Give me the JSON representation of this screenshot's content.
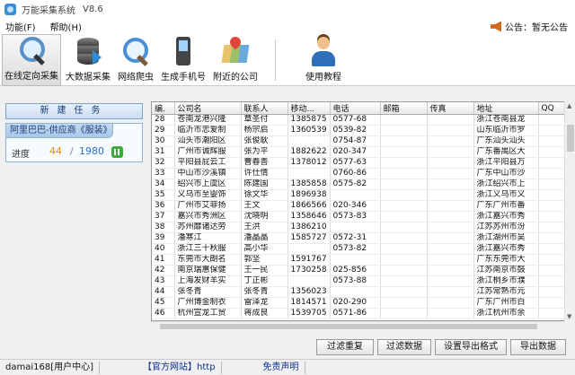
{
  "window": {
    "title": "万能采集系统",
    "version": "V8.6"
  },
  "menu": [
    "功能(F)",
    "帮助(H)"
  ],
  "notice": "公告：暂无公告",
  "toolbar": [
    {
      "label": "在线定向采集",
      "icon": "search-icon"
    },
    {
      "label": "大数据采集",
      "icon": "database-icon"
    },
    {
      "label": "网络爬虫",
      "icon": "magnifier-icon"
    },
    {
      "label": "生成手机号",
      "icon": "phone-icon"
    },
    {
      "label": "附近的公司",
      "icon": "map-pin-icon"
    },
    {
      "label": "使用教程",
      "icon": "user-icon"
    }
  ],
  "left": {
    "new_task": "新建任务",
    "task_title": "阿里巴巴-供应商《服装》",
    "progress_label": "进度",
    "progress_current": "44",
    "progress_sep": "/",
    "progress_total": "1980"
  },
  "table": {
    "columns": [
      "编.",
      "公司名",
      "联系人",
      "移动...",
      "电话",
      "邮箱",
      "传真",
      "地址",
      "QQ"
    ],
    "rows": [
      [
        "28",
        "苍南龙港兴隆",
        "章圣付",
        "1385875",
        "0577-68",
        "",
        "",
        "浙江苍南县龙",
        ""
      ],
      [
        "29",
        "临沂市忠爱制",
        "杨宗启",
        "1360539",
        "0539-82",
        "",
        "",
        "山东临沂市罗",
        ""
      ],
      [
        "30",
        "汕头市潮阳区",
        "张俊耿",
        "",
        "0754-87",
        "",
        "",
        "广东汕头汕头",
        ""
      ],
      [
        "31",
        "广州市诚辉服",
        "张为平",
        "1882622",
        "020-347",
        "",
        "",
        "广东番禺区大",
        ""
      ],
      [
        "32",
        "平阳县屁云工",
        "曹春善",
        "1378012",
        "0577-63",
        "",
        "",
        "浙江平阳县万",
        ""
      ],
      [
        "33",
        "中山市沙溪镇",
        "许仕情",
        "",
        "0760-86",
        "",
        "",
        "广东中山市沙",
        ""
      ],
      [
        "34",
        "绍兴市上虞区",
        "陈建国",
        "1385858",
        "0575-82",
        "",
        "",
        "浙江绍兴市上",
        ""
      ],
      [
        "35",
        "义乌市至婴饰",
        "徐文华",
        "1896938",
        "",
        "",
        "",
        "浙江义乌市义",
        ""
      ],
      [
        "36",
        "广州市艾菲扬",
        "王文",
        "1866566",
        "020-346",
        "",
        "",
        "广东广州市番",
        ""
      ],
      [
        "37",
        "嘉兴市秀洲区",
        "沈晓明",
        "1358646",
        "0573-83",
        "",
        "",
        "浙江嘉兴市秀",
        ""
      ],
      [
        "38",
        "苏州靡诸达劳",
        "王洪",
        "1386210",
        "",
        "",
        "",
        "江苏苏州市汾",
        ""
      ],
      [
        "39",
        "潘寒江",
        "潘晶晶",
        "1585727",
        "0572-31",
        "",
        "",
        "浙江湖州市吴",
        ""
      ],
      [
        "40",
        "浙江三十秋服",
        "高小华",
        "",
        "0573-82",
        "",
        "",
        "浙江嘉兴市秀",
        ""
      ],
      [
        "41",
        "东莞市大朗名",
        "郭坚",
        "1591767",
        "",
        "",
        "",
        "广东东莞市大",
        ""
      ],
      [
        "42",
        "南京瑞惠保健",
        "王一民",
        "1730258",
        "025-856",
        "",
        "",
        "江苏南京市鼓",
        ""
      ],
      [
        "43",
        "上海发财羊实",
        "丁正彬",
        "",
        "0573-88",
        "",
        "",
        "浙江桐乡市濮",
        ""
      ],
      [
        "44",
        "张冬青",
        "张冬青",
        "1356023",
        "",
        "",
        "",
        "江苏常熟市元",
        ""
      ],
      [
        "45",
        "广州博金制衣",
        "雷泽龙",
        "1814571",
        "020-290",
        "",
        "",
        "广东广州市白",
        ""
      ],
      [
        "46",
        "杭州宣龙工贸",
        "蒋成良",
        "1539705",
        "0571-86",
        "",
        "",
        "浙江杭州市余",
        ""
      ]
    ]
  },
  "buttons": [
    "过滤重复",
    "过滤数据",
    "设置导出格式",
    "导出数据"
  ],
  "status": {
    "user": "damai168[用户中心]",
    "site": "【官方网站】http",
    "free": "免责声明"
  }
}
